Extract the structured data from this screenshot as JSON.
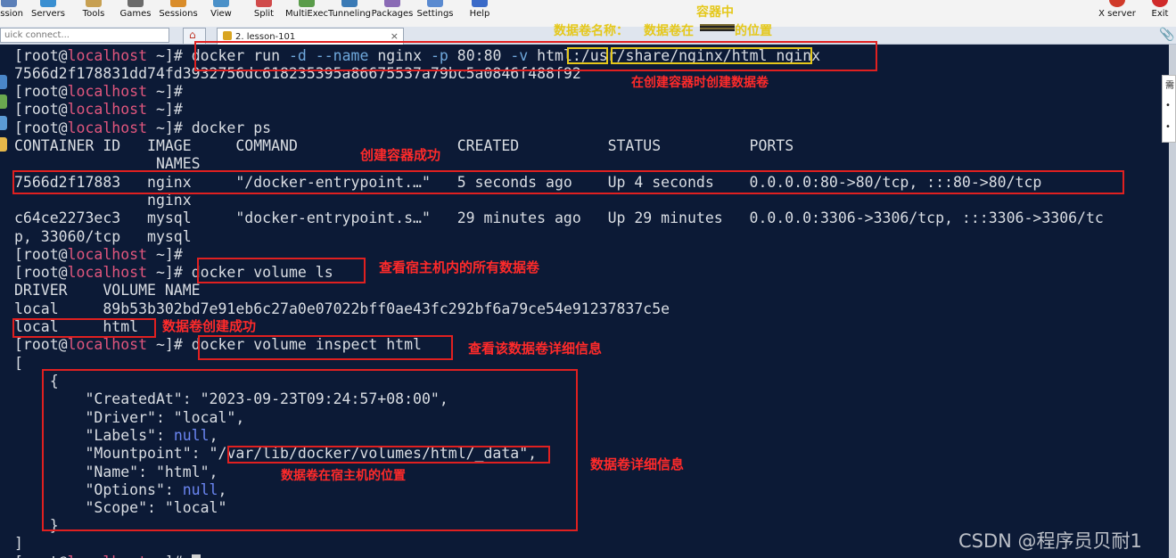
{
  "toolbar": {
    "items": [
      {
        "label": "ession",
        "icon": "session-icon",
        "color": "#5b7fb8"
      },
      {
        "label": "Servers",
        "icon": "servers-icon",
        "color": "#3a8fd1"
      },
      {
        "label": "Tools",
        "icon": "tools-icon",
        "color": "#c7a052"
      },
      {
        "label": "Games",
        "icon": "games-icon",
        "color": "#6b6b6b"
      },
      {
        "label": "Sessions",
        "icon": "sessions-icon",
        "color": "#d98c2a"
      },
      {
        "label": "View",
        "icon": "view-icon",
        "color": "#4a90c8"
      },
      {
        "label": "Split",
        "icon": "split-icon",
        "color": "#d04a4a"
      },
      {
        "label": "MultiExec",
        "icon": "multiexec-icon",
        "color": "#5a9c4a"
      },
      {
        "label": "Tunneling",
        "icon": "tunneling-icon",
        "color": "#3a7ab5"
      },
      {
        "label": "Packages",
        "icon": "packages-icon",
        "color": "#8a6ab5"
      },
      {
        "label": "Settings",
        "icon": "settings-icon",
        "color": "#5a8ad0"
      },
      {
        "label": "Help",
        "icon": "help-icon",
        "color": "#3a6ac8"
      }
    ],
    "right_items": [
      {
        "label": "X server",
        "icon": "x-server-icon",
        "color": "#d03a2a"
      },
      {
        "label": "Exit",
        "icon": "exit-icon",
        "color": "#d02a2a"
      }
    ]
  },
  "tabs": {
    "quick_connect_placeholder": "uick connect...",
    "home_icon": "home-icon",
    "session_tab_label": "2. lesson-101",
    "session_tab_close": "×",
    "attach_icon": "paperclip-icon"
  },
  "terminal": {
    "prompt_user": "[root@",
    "prompt_host": "localhost",
    "prompt_tail": " ~]#",
    "cmd_run_a": " docker run ",
    "cmd_run_opt_d": "-d",
    "cmd_run_b": " ",
    "cmd_run_opt_name": "--name",
    "cmd_run_c": " nginx ",
    "cmd_run_opt_p": "-p",
    "cmd_run_d": " 80:80 ",
    "cmd_run_opt_v": "-v",
    "cmd_run_e": " html:/usr/share/nginx/html nginx",
    "container_hash": "7566d2f178831dd74fd3932756dc618235395a86675537a79bc5a0846f488f92",
    "cmd_ps": " docker ps",
    "ps_header": "CONTAINER ID   IMAGE     COMMAND                  CREATED          STATUS          PORTS",
    "ps_header_names": "                NAMES",
    "ps_row1": "7566d2f17883   nginx     \"/docker-entrypoint.…\"   5 seconds ago    Up 4 seconds    0.0.0.0:80->80/tcp, :::80->80/tcp",
    "ps_row1_names": "               nginx",
    "ps_row2": "c64ce2273ec3   mysql     \"docker-entrypoint.s…\"   29 minutes ago   Up 29 minutes   0.0.0.0:3306->3306/tcp, :::3306->3306/tc",
    "ps_row2_wrap": "p, 33060/tcp   mysql",
    "cmd_volume_ls": " docker volume ls",
    "vol_header": "DRIVER    VOLUME NAME",
    "vol_row1": "local     89b53b302bd7e91eb6c27a0e07022bff0ae43fc292bf6a79ce54e91237837c5e",
    "vol_row2": "local     html",
    "cmd_inspect": " docker volume inspect html",
    "json_open_bracket": "[",
    "json_open_brace": "    {",
    "json_created": "        \"CreatedAt\": \"2023-09-23T09:24:57+08:00\",",
    "json_driver": "        \"Driver\": \"local\",",
    "json_labels_key": "        \"Labels\": ",
    "json_null": "null",
    "json_comma": ",",
    "json_mountpoint": "        \"Mountpoint\": \"/var/lib/docker/volumes/html/_data\",",
    "json_name": "        \"Name\": \"html\",",
    "json_options_key": "        \"Options\": ",
    "json_scope": "        \"Scope\": \"local\"",
    "json_close_brace": "    }",
    "json_close_bracket": "]",
    "last_prompt_tail": " ~]# "
  },
  "annotations": {
    "container_mid": "容器中",
    "volume_name": "数据卷名称：",
    "volume_pos_a": "数据卷在",
    "volume_pos_b": "的位置",
    "create_on_run": "在创建容器时创建数据卷",
    "container_ok": "创建容器成功",
    "list_all": "查看宿主机内的所有数据卷",
    "volume_ok": "数据卷创建成功",
    "inspect_detail": "查看该数据卷详细信息",
    "host_location": "数据卷在宿主机的位置",
    "detail_info": "数据卷详细信息"
  },
  "right_panel": {
    "chars": [
      "需",
      "•",
      "•"
    ]
  },
  "watermark": "CSDN @程序员贝耐1",
  "colors": {
    "terminal_bg": "#0c1a36",
    "terminal_fg": "#d9dde3",
    "hostname": "#e0567d",
    "option": "#6fa8dc",
    "null_keyword": "#6b86f2",
    "annotation_red": "#ff2a2a",
    "annotation_yellow": "#e5c81a"
  }
}
